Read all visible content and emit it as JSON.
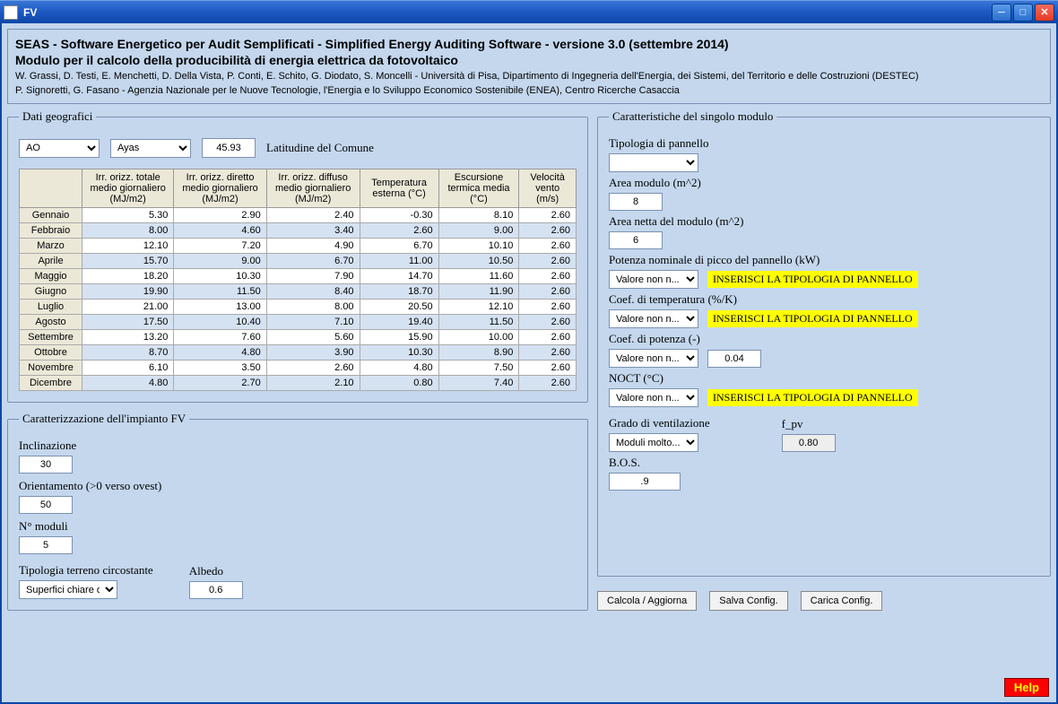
{
  "window": {
    "title": "FV"
  },
  "header": {
    "line1": "SEAS - Software Energetico per Audit Semplificati - Simplified Energy Auditing Software - versione 3.0 (settembre 2014)",
    "line2": "Modulo per il calcolo della producibilità di energia elettrica da fotovoltaico",
    "credits1": "W. Grassi, D. Testi, E. Menchetti, D. Della Vista, P. Conti, E. Schito, G. Diodato, S. Moncelli - Università di Pisa, Dipartimento di Ingegneria dell'Energia, dei Sistemi, del Territorio e delle Costruzioni (DESTEC)",
    "credits2": "P. Signoretti, G. Fasano - Agenzia Nazionale per le Nuove Tecnologie, l'Energia e lo Sviluppo Economico Sostenibile (ENEA), Centro Ricerche Casaccia"
  },
  "geo": {
    "legend": "Dati geografici",
    "prov": "AO",
    "comune": "Ayas",
    "lat": "45.93",
    "lat_label": "Latitudine del Comune",
    "cols": [
      "Irr. orizz. totale medio giornaliero (MJ/m2)",
      "Irr. orizz. diretto medio giornaliero (MJ/m2)",
      "Irr. orizz. diffuso medio giornaliero (MJ/m2)",
      "Temperatura esterna (°C)",
      "Escursione termica media (°C)",
      "Velocità vento (m/s)"
    ],
    "months": [
      "Gennaio",
      "Febbraio",
      "Marzo",
      "Aprile",
      "Maggio",
      "Giugno",
      "Luglio",
      "Agosto",
      "Settembre",
      "Ottobre",
      "Novembre",
      "Dicembre"
    ],
    "rows": [
      [
        "5.30",
        "2.90",
        "2.40",
        "-0.30",
        "8.10",
        "2.60"
      ],
      [
        "8.00",
        "4.60",
        "3.40",
        "2.60",
        "9.00",
        "2.60"
      ],
      [
        "12.10",
        "7.20",
        "4.90",
        "6.70",
        "10.10",
        "2.60"
      ],
      [
        "15.70",
        "9.00",
        "6.70",
        "11.00",
        "10.50",
        "2.60"
      ],
      [
        "18.20",
        "10.30",
        "7.90",
        "14.70",
        "11.60",
        "2.60"
      ],
      [
        "19.90",
        "11.50",
        "8.40",
        "18.70",
        "11.90",
        "2.60"
      ],
      [
        "21.00",
        "13.00",
        "8.00",
        "20.50",
        "12.10",
        "2.60"
      ],
      [
        "17.50",
        "10.40",
        "7.10",
        "19.40",
        "11.50",
        "2.60"
      ],
      [
        "13.20",
        "7.60",
        "5.60",
        "15.90",
        "10.00",
        "2.60"
      ],
      [
        "8.70",
        "4.80",
        "3.90",
        "10.30",
        "8.90",
        "2.60"
      ],
      [
        "6.10",
        "3.50",
        "2.60",
        "4.80",
        "7.50",
        "2.60"
      ],
      [
        "4.80",
        "2.70",
        "2.10",
        "0.80",
        "7.40",
        "2.60"
      ]
    ]
  },
  "plant": {
    "legend": "Caratterizzazione dell'impianto FV",
    "incl_label": "Inclinazione",
    "incl": "30",
    "orient_label": "Orientamento (>0 verso ovest)",
    "orient": "50",
    "nmod_label": "N° moduli",
    "nmod": "5",
    "terr_label": "Tipologia terreno circostante",
    "terr": "Superfici chiare di e...",
    "albedo_label": "Albedo",
    "albedo": "0.6"
  },
  "module": {
    "legend": "Caratteristiche del singolo modulo",
    "type_label": "Tipologia di pannello",
    "type": "",
    "area_label": "Area modulo (m^2)",
    "area": "8",
    "net_label": "Area netta del modulo (m^2)",
    "net": "6",
    "pnom_label": "Potenza nominale di picco del pannello (kW)",
    "warn_msg": "INSERISCI LA TIPOLOGIA DI PANNELLO",
    "valnon": "Valore non n...",
    "coeft_label": "Coef. di temperatura (%/K)",
    "coefp_label": "Coef. di potenza (-)",
    "coefp_val": "0.04",
    "noct_label": "NOCT (°C)",
    "vent_label": "Grado di ventilazione",
    "vent": "Moduli molto...",
    "fpv_label": "f_pv",
    "fpv": "0.80",
    "bos_label": "B.O.S.",
    "bos": ".9"
  },
  "buttons": {
    "calc": "Calcola / Aggiorna",
    "save": "Salva Config.",
    "load": "Carica Config.",
    "help": "Help"
  }
}
